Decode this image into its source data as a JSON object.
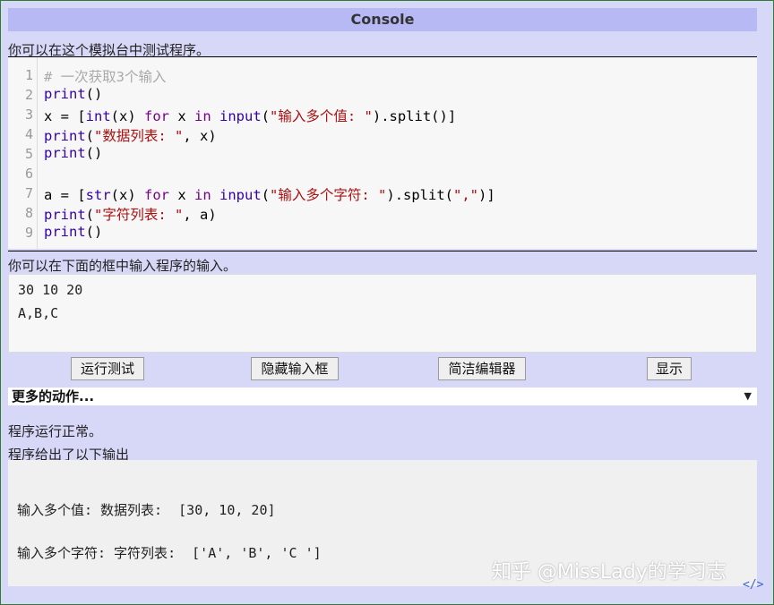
{
  "title": "Console",
  "intro_text": "你可以在这个模拟台中测试程序。",
  "code_lines": [
    {
      "num": "1",
      "parts": [
        {
          "t": "# 一次获取3个输入",
          "c": "cmt"
        }
      ]
    },
    {
      "num": "2",
      "parts": [
        {
          "t": "print",
          "c": "bi"
        },
        {
          "t": "()",
          "c": ""
        }
      ]
    },
    {
      "num": "3",
      "parts": [
        {
          "t": "x = [",
          "c": ""
        },
        {
          "t": "int",
          "c": "bi"
        },
        {
          "t": "(x) ",
          "c": ""
        },
        {
          "t": "for",
          "c": "kw"
        },
        {
          "t": " x ",
          "c": ""
        },
        {
          "t": "in",
          "c": "kw"
        },
        {
          "t": " ",
          "c": ""
        },
        {
          "t": "input",
          "c": "bi"
        },
        {
          "t": "(",
          "c": ""
        },
        {
          "t": "\"输入多个值: \"",
          "c": "str"
        },
        {
          "t": ").split()]",
          "c": ""
        }
      ]
    },
    {
      "num": "4",
      "parts": [
        {
          "t": "print",
          "c": "bi"
        },
        {
          "t": "(",
          "c": ""
        },
        {
          "t": "\"数据列表: \"",
          "c": "str"
        },
        {
          "t": ", x)",
          "c": ""
        }
      ]
    },
    {
      "num": "5",
      "parts": [
        {
          "t": "print",
          "c": "bi"
        },
        {
          "t": "()",
          "c": ""
        }
      ]
    },
    {
      "num": "6",
      "parts": []
    },
    {
      "num": "7",
      "parts": [
        {
          "t": "a = [",
          "c": ""
        },
        {
          "t": "str",
          "c": "bi"
        },
        {
          "t": "(x) ",
          "c": ""
        },
        {
          "t": "for",
          "c": "kw"
        },
        {
          "t": " x ",
          "c": ""
        },
        {
          "t": "in",
          "c": "kw"
        },
        {
          "t": " ",
          "c": ""
        },
        {
          "t": "input",
          "c": "bi"
        },
        {
          "t": "(",
          "c": ""
        },
        {
          "t": "\"输入多个字符: \"",
          "c": "str"
        },
        {
          "t": ").split(",
          "c": ""
        },
        {
          "t": "\",\"",
          "c": "str"
        },
        {
          "t": ")]",
          "c": ""
        }
      ]
    },
    {
      "num": "8",
      "parts": [
        {
          "t": "print",
          "c": "bi"
        },
        {
          "t": "(",
          "c": ""
        },
        {
          "t": "\"字符列表: \"",
          "c": "str"
        },
        {
          "t": ", a)",
          "c": ""
        }
      ]
    },
    {
      "num": "9",
      "parts": [
        {
          "t": "print",
          "c": "bi"
        },
        {
          "t": "()",
          "c": ""
        }
      ]
    }
  ],
  "input_label": "你可以在下面的框中输入程序的输入。",
  "input_lines": [
    "30 10 20",
    "A,B,C"
  ],
  "buttons": {
    "run": "运行测试",
    "hide_input": "隐藏输入框",
    "simple_editor": "简洁编辑器",
    "show": "显示"
  },
  "more_actions": "更多的动作...",
  "status_text": "程序运行正常。",
  "output_label": "程序给出了以下输出",
  "output_lines": [
    "输入多个值: 数据列表:  [30, 10, 20]",
    "输入多个字符: 字符列表:  ['A', 'B', 'C ']"
  ],
  "watermark": "知乎 @MissLady的学习志",
  "icons": {
    "dropdown": "chevron-down-icon",
    "code": "code-icon"
  }
}
